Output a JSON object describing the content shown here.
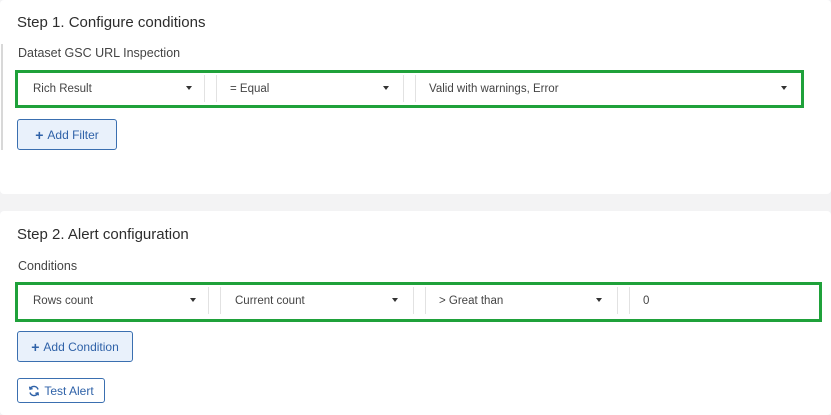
{
  "step1": {
    "title": "Step 1. Configure conditions",
    "dataset_label": "Dataset GSC URL Inspection",
    "filter": {
      "field": "Rich Result",
      "operator": "= Equal",
      "value": "Valid with warnings, Error"
    },
    "add_filter_label": "Add Filter",
    "add_filter_icon": "plus-icon"
  },
  "step2": {
    "title": "Step 2. Alert configuration",
    "conditions_label": "Conditions",
    "condition": {
      "metric": "Rows count",
      "aggregation": "Current count",
      "comparator": "> Great than",
      "threshold": "0"
    },
    "add_condition_label": "Add Condition",
    "add_condition_icon": "plus-icon",
    "test_alert_label": "Test Alert",
    "test_alert_icon": "refresh-icon"
  },
  "colors": {
    "highlight_border": "#1fa13a",
    "button_text": "#2f62a8",
    "button_bg": "#e9f1fb"
  }
}
